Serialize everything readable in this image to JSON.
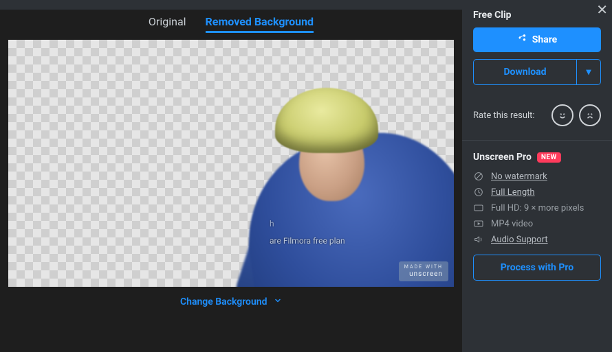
{
  "tabs": {
    "original": "Original",
    "removed": "Removed Background"
  },
  "preview": {
    "watermark_line1": "h",
    "watermark_line2": "are Filmora free plan",
    "made_with_small": "MADE WITH",
    "made_with_brand": "unscreen"
  },
  "change_bg": "Change Background",
  "sidebar": {
    "free_clip": "Free Clip",
    "share": "Share",
    "download": "Download",
    "download_caret": "▾",
    "rate_label": "Rate this result:"
  },
  "pro": {
    "title": "Unscreen Pro",
    "badge": "NEW",
    "features": {
      "no_watermark": "No watermark",
      "full_length": "Full Length",
      "full_hd": "Full HD: 9 × more pixels",
      "mp4": "MP4 video",
      "audio": "Audio Support"
    },
    "process": "Process with Pro"
  }
}
